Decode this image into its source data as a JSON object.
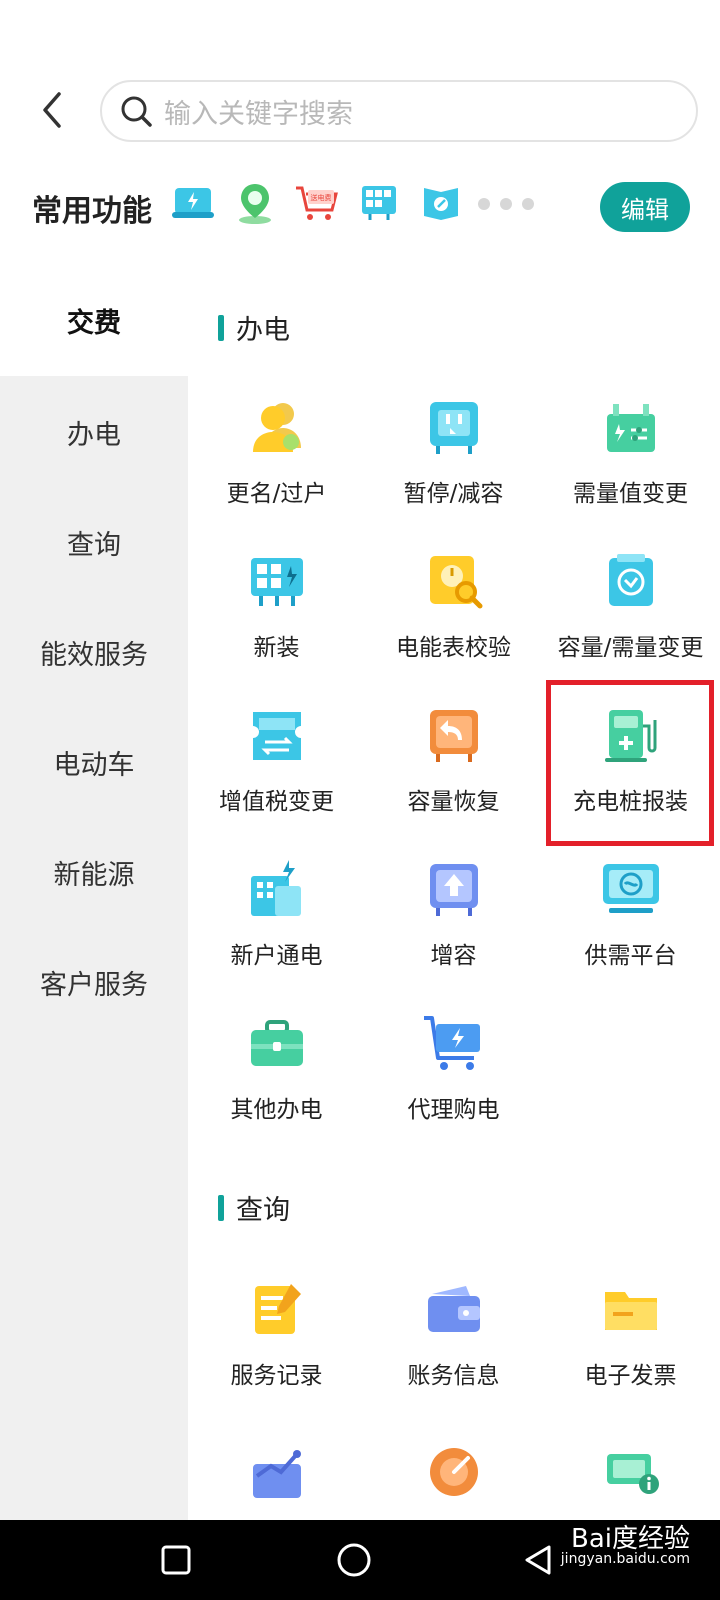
{
  "search": {
    "placeholder": "输入关键字搜索"
  },
  "favorites": {
    "title": "常用功能",
    "edit_label": "编辑",
    "cart_badge": "送电费",
    "icons": [
      "payment-card-icon",
      "location-pin-icon",
      "shopping-cart-icon",
      "meter-grid-icon",
      "book-icon"
    ]
  },
  "sidebar": {
    "items": [
      {
        "label": "交费",
        "active": true
      },
      {
        "label": "办电",
        "active": false
      },
      {
        "label": "查询",
        "active": false
      },
      {
        "label": "能效服务",
        "active": false
      },
      {
        "label": "电动车",
        "active": false
      },
      {
        "label": "新能源",
        "active": false
      },
      {
        "label": "客户服务",
        "active": false
      }
    ]
  },
  "sections": {
    "banDian": {
      "title": "办电",
      "items": [
        {
          "label": "更名/过户",
          "icon": "user-transfer-icon"
        },
        {
          "label": "暂停/减容",
          "icon": "pause-device-icon"
        },
        {
          "label": "需量值变更",
          "icon": "demand-adjust-icon"
        },
        {
          "label": "新装",
          "icon": "new-install-icon"
        },
        {
          "label": "电能表校验",
          "icon": "meter-check-icon"
        },
        {
          "label": "容量/需量变更",
          "icon": "capacity-change-icon"
        },
        {
          "label": "增值税变更",
          "icon": "tax-change-icon"
        },
        {
          "label": "容量恢复",
          "icon": "capacity-restore-icon"
        },
        {
          "label": "充电桩报装",
          "icon": "charging-pile-icon"
        },
        {
          "label": "新户通电",
          "icon": "new-household-icon"
        },
        {
          "label": "增容",
          "icon": "capacity-increase-icon"
        },
        {
          "label": "供需平台",
          "icon": "supply-demand-icon"
        },
        {
          "label": "其他办电",
          "icon": "briefcase-icon"
        },
        {
          "label": "代理购电",
          "icon": "agent-purchase-cart-icon"
        }
      ]
    },
    "chaXun": {
      "title": "查询",
      "items": [
        {
          "label": "服务记录",
          "icon": "service-record-icon"
        },
        {
          "label": "账务信息",
          "icon": "wallet-icon"
        },
        {
          "label": "电子发票",
          "icon": "invoice-icon"
        }
      ]
    }
  },
  "watermark": {
    "text": "Bai度经验",
    "site": "jingyan.baidu.com"
  },
  "colors": {
    "accent": "#10a29a",
    "highlight": "#e3202a"
  }
}
